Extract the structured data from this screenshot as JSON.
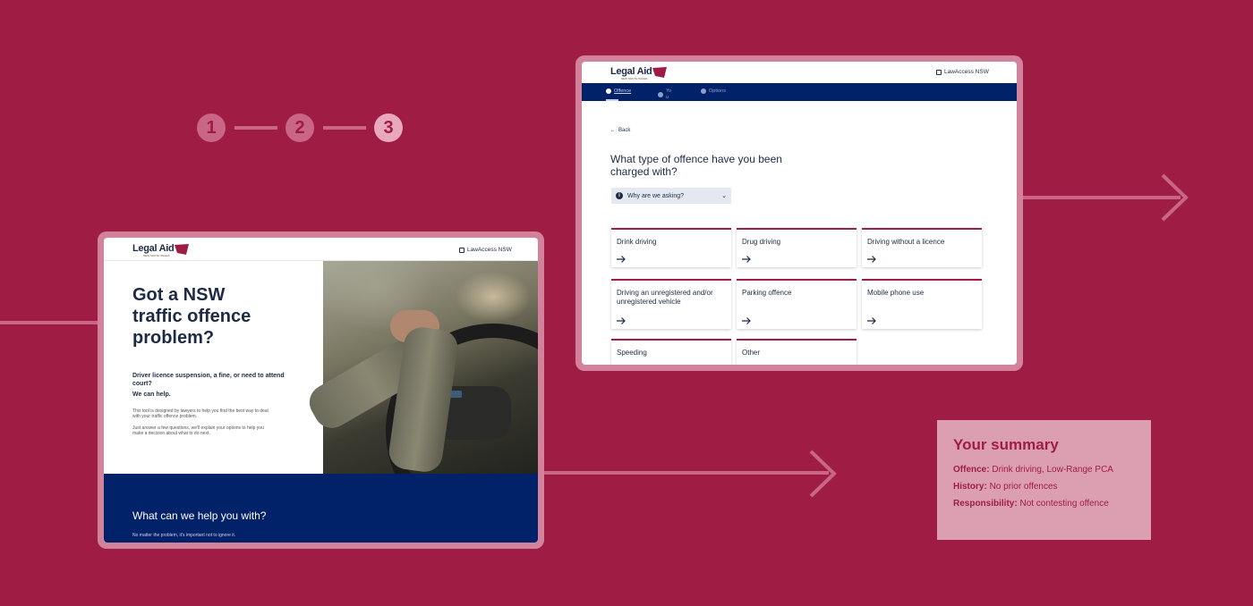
{
  "steps": [
    "1",
    "2",
    "3"
  ],
  "screen1": {
    "logo": {
      "text": "Legal Aid",
      "sub": "NEW SOUTH WALES"
    },
    "header_link": "LawAccess NSW",
    "hero_title": "Got a NSW traffic offence problem?",
    "subheading": "Driver licence suspension, a fine, or need to attend court?",
    "we_can_help": "We can help.",
    "desc1": "This tool is designed by lawyers to help you find the best way to deal with your traffic offence problem.",
    "desc2": "Just answer a few questions, we'll explain your options to help you make a decision about what to do next.",
    "footer_title": "What can we help you with?",
    "footer_text": "No matter the problem, it's important not to ignore it."
  },
  "screen2": {
    "logo": {
      "text": "Legal Aid",
      "sub": "NEW SOUTH WALES"
    },
    "header_link": "LawAccess NSW",
    "nav_steps": [
      "Offence",
      "Yo u",
      "Options"
    ],
    "back_label": "Back",
    "question": "What type of offence have you been charged with?",
    "why_label": "Why are we asking?",
    "offence_cards": [
      "Drink driving",
      "Drug driving",
      "Driving without a licence",
      "Driving an unregistered and/or unregistered vehicle",
      "Parking offence",
      "Mobile phone use",
      "Speeding",
      "Other"
    ]
  },
  "summary": {
    "title": "Your summary",
    "rows": [
      {
        "key": "Offence:",
        "value": "Drink driving, Low-Range PCA"
      },
      {
        "key": "History:",
        "value": "No prior offences"
      },
      {
        "key": "Responsibility:",
        "value": "Not contesting offence"
      }
    ]
  },
  "colors": {
    "background": "#9f1d45",
    "navy": "#012169",
    "accent": "#9f1d45",
    "frame": "#d3829b",
    "summary_bg": "#dc9fb2"
  },
  "icons": [
    "external-link-icon",
    "arrow-right-icon",
    "arrow-left-icon",
    "info-icon",
    "chevron-down-icon"
  ]
}
